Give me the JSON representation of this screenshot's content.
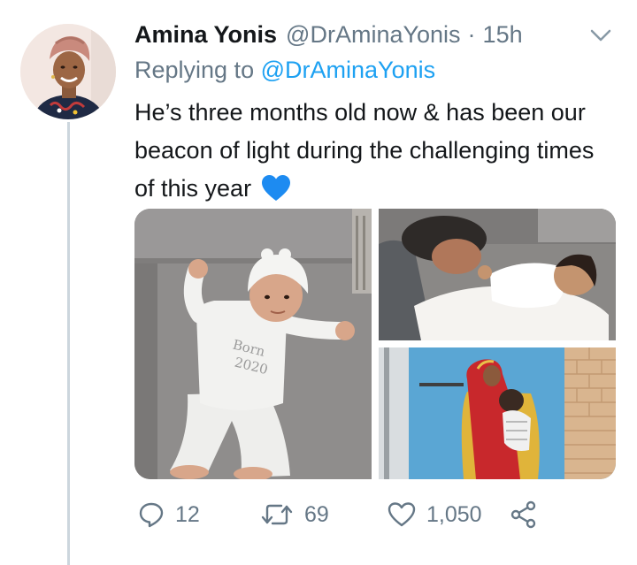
{
  "tweet": {
    "author_name": "Amina Yonis",
    "author_handle": "@DrAminaYonis",
    "separator": "·",
    "time": "15h",
    "replying_prefix": "Replying to",
    "replying_to": "@DrAminaYonis",
    "text": "He’s three months old now & has been our beacon of light during the challenging times of this year",
    "emoji": "blue-heart-icon",
    "photo_text": "Born 2020",
    "photos": [
      "baby-lying-on-couch-photo",
      "father-with-baby-photo",
      "mother-holding-baby-photo"
    ]
  },
  "actions": {
    "replies": "12",
    "retweets": "69",
    "likes": "1,050"
  },
  "colors": {
    "text": "#14171a",
    "secondary": "#657786",
    "link": "#1da1f2",
    "thread_line": "#ccd6dd",
    "heart": "#1d8bf1"
  }
}
